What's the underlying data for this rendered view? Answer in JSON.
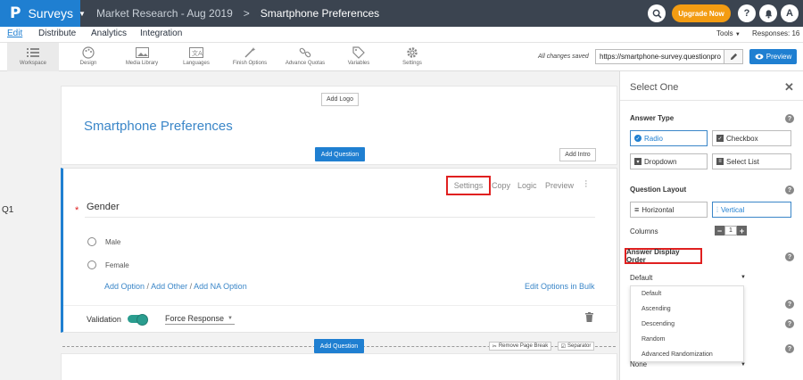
{
  "topbar": {
    "logo": "P",
    "app_name": "Surveys",
    "crumb_folder": "Market Research - Aug 2019",
    "crumb_sep": ">",
    "crumb_current": "Smartphone Preferences",
    "upgrade_label": "Upgrade Now",
    "avatar_letter": "A"
  },
  "menubar": {
    "items": [
      "Edit",
      "Distribute",
      "Analytics",
      "Integration"
    ],
    "tools_label": "Tools",
    "responses_label": "Responses: 16"
  },
  "toolbar": {
    "items": [
      "Workspace",
      "Design",
      "Media Library",
      "Languages",
      "Finish Options",
      "Advance Quotas",
      "Variables",
      "Settings"
    ],
    "saved_text": "All changes saved",
    "url": "https://smartphone-survey.questionpro",
    "preview_label": "Preview"
  },
  "canvas": {
    "question_number": "Q1",
    "add_logo": "Add Logo",
    "survey_title": "Smartphone Preferences",
    "add_question": "Add Question",
    "add_intro": "Add Intro",
    "question": {
      "links": [
        "Settings",
        "Copy",
        "Logic",
        "Preview"
      ],
      "required_mark": "*",
      "title": "Gender",
      "options": [
        "Male",
        "Female"
      ],
      "add_option": "Add Option",
      "add_other": "Add Other",
      "add_na": "Add NA Option",
      "separator": "/",
      "edit_bulk": "Edit Options in Bulk",
      "validation_label": "Validation",
      "validation_value": "Force Response"
    },
    "add_question_2": "Add Question",
    "remove_page_break": "Remove Page Break",
    "separator_label": "Separator"
  },
  "panel": {
    "title": "Select One",
    "answer_type_label": "Answer Type",
    "answer_types": [
      "Radio",
      "Checkbox",
      "Dropdown",
      "Select List"
    ],
    "layout_label": "Question Layout",
    "layouts": [
      "Horizontal",
      "Vertical"
    ],
    "columns_label": "Columns",
    "columns_value": "1",
    "display_order_label": "Answer Display Order",
    "display_order_value": "Default",
    "display_order_options": [
      "Default",
      "Ascending",
      "Descending",
      "Random",
      "Advanced Randomization"
    ],
    "bottom_select_value": "None"
  }
}
